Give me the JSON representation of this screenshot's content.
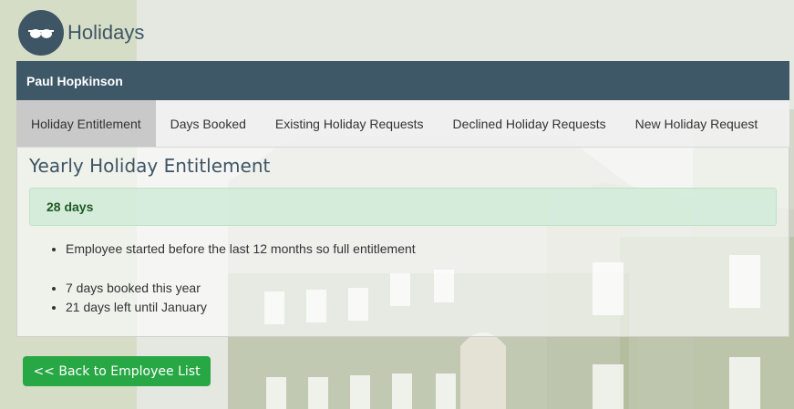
{
  "app": {
    "title": "Holidays",
    "logo_icon": "sunglasses-icon"
  },
  "panel": {
    "employee_name": "Paul Hopkinson"
  },
  "tabs": [
    {
      "label": "Holiday Entitlement",
      "active": true
    },
    {
      "label": "Days Booked",
      "active": false
    },
    {
      "label": "Existing Holiday Requests",
      "active": false
    },
    {
      "label": "Declined Holiday Requests",
      "active": false
    },
    {
      "label": "New Holiday Request",
      "active": false
    }
  ],
  "content": {
    "heading": "Yearly Holiday Entitlement",
    "entitlement": "28 days",
    "notes": [
      "Employee started before the last 12 months so full entitlement"
    ],
    "summary": [
      "7 days booked this year",
      "21 days left until January"
    ]
  },
  "actions": {
    "back_label": "<< Back to Employee List"
  },
  "colors": {
    "primary": "#3e5868",
    "success": "#28a745",
    "alert_bg": "#d4ebda"
  }
}
